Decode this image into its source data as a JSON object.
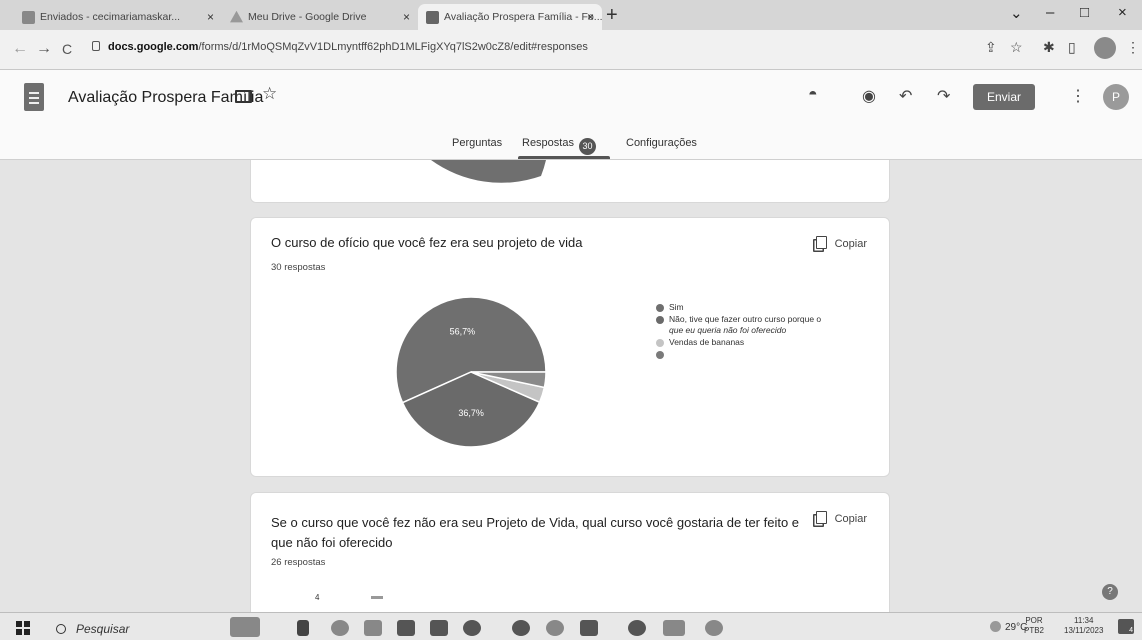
{
  "browser": {
    "tabs": [
      {
        "label": "Enviados - cecimariamaskar...",
        "active": false
      },
      {
        "label": "Meu Drive - Google Drive",
        "active": false
      },
      {
        "label": "Avaliação Prospera Família - Fo...",
        "active": true
      }
    ],
    "url_host": "docs.google.com",
    "url_path": "/forms/d/1rMoQSMqZvV1DLmyntff62phD1MLFigXYq7lS2w0cZ8/edit#responses"
  },
  "form": {
    "title": "Avaliação Prospera Família",
    "send_label": "Enviar",
    "avatar_letter": "P",
    "tabs": {
      "questions": "Perguntas",
      "responses": "Respostas",
      "responses_count": "30",
      "settings": "Configurações"
    }
  },
  "questions": [
    {
      "title": "O curso de ofício que você fez era seu projeto de vida",
      "count": "30 respostas",
      "copy_label": "Copiar",
      "legend": [
        {
          "label": "Sim",
          "continuation": ""
        },
        {
          "label": "Não, tive que fazer outro curso porque o",
          "continuation": "que eu queria não foi oferecido"
        },
        {
          "label": "Vendas de bananas",
          "continuation": ""
        },
        {
          "label": "",
          "continuation": ""
        }
      ],
      "slice_labels": [
        "56,7%",
        "36,7%"
      ]
    },
    {
      "title": "Se o curso que você fez não era seu Projeto de Vida, qual curso você gostaria de ter feito e que não foi oferecido",
      "count": "26 respostas",
      "copy_label": "Copiar",
      "footer_number": "4"
    }
  ],
  "chart_data": {
    "type": "pie",
    "title": "O curso de ofício que você fez era seu projeto de vida",
    "categories": [
      "Sim",
      "Não, tive que fazer outro curso porque o que eu queria não foi oferecido",
      "Vendas de bananas",
      ""
    ],
    "values": [
      56.7,
      36.7,
      3.3,
      3.3
    ],
    "colors": [
      "#6f6f6f",
      "#6a6a6a",
      "#c4c4c4",
      "#8a8a8a"
    ],
    "legend_position": "right"
  },
  "taskbar": {
    "search_placeholder": "Pesquisar",
    "weather": "29°C",
    "lang_top": "POR",
    "lang_bottom": "PTB2",
    "time": "11:34",
    "date": "13/11/2023",
    "notif_count": "4"
  },
  "icons": {
    "tab_close": "×",
    "new_tab": "+",
    "back": "←",
    "forward": "→",
    "reload": "C",
    "share": "⇪",
    "bookmark": "☆",
    "extensions": "✱",
    "sidebar": "▯",
    "menu": "⋮",
    "palette": "◓",
    "preview": "◉",
    "undo": "↶",
    "redo": "↷",
    "star": "☆",
    "minimize": "–",
    "maximize": "□",
    "close": "×",
    "chevron": "⌄",
    "help": "?"
  }
}
